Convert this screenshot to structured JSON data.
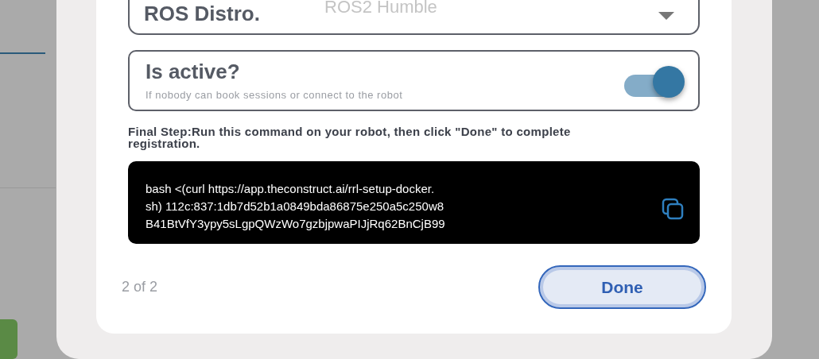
{
  "ros_distro": {
    "label": "ROS Distro.",
    "value": "ROS2 Humble"
  },
  "active": {
    "title": "Is active?",
    "hint": "If nobody can book sessions or connect to the robot",
    "on": true
  },
  "instructions": "Final Step:Run this command on your robot, then click \"Done\" to complete registration.",
  "command_lines": [
    "bash <(curl https://app.theconstruct.ai/rrl-setup-docker.",
    "sh) 112c:837:1db7d52b1a0849bda86875e250a5c250w8",
    "B41BtVfY3ypy5sLgpQWzWo7gzbjpwaPIJjRq62BnCjB99"
  ],
  "step": "2 of 2",
  "done_button": "Done"
}
